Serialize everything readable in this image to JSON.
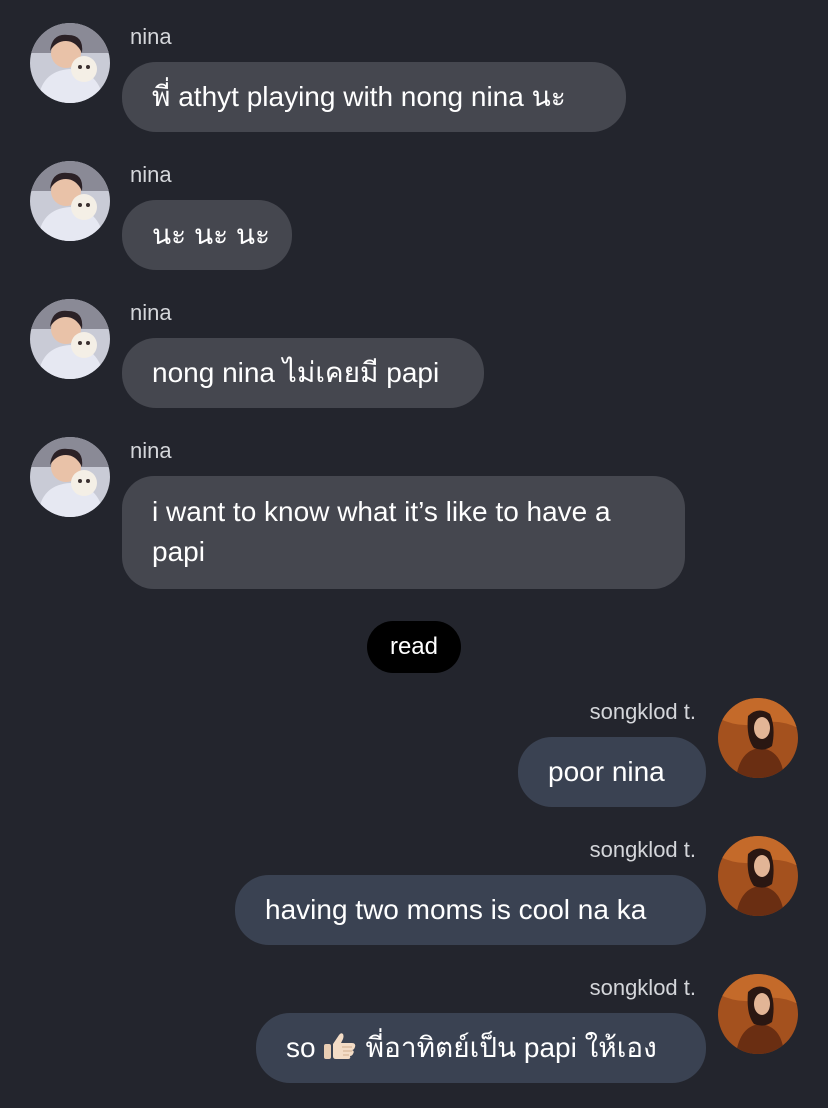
{
  "messages_in": [
    {
      "sender": "nina",
      "text": "พี่ athyt playing with nong nina นะ"
    },
    {
      "sender": "nina",
      "text": "นะ นะ นะ"
    },
    {
      "sender": "nina",
      "text": "nong nina ไม่เคยมี papi"
    },
    {
      "sender": "nina",
      "text": "i want to know what it’s like to have a papi"
    }
  ],
  "read_receipt": "read",
  "messages_out": [
    {
      "sender": "songklod t.",
      "text": "poor nina"
    },
    {
      "sender": "songklod t.",
      "text": "having two moms is cool na ka"
    },
    {
      "sender": "songklod t.",
      "text_before": "so",
      "emoji": "thumbs-up",
      "text_after": "พี่อาทิตย์เป็น papi ให้เอง"
    }
  ],
  "colors": {
    "background": "#23252d",
    "incoming_bubble": "#45474f",
    "outgoing_bubble": "#3a4252",
    "read_pill": "#000000"
  }
}
